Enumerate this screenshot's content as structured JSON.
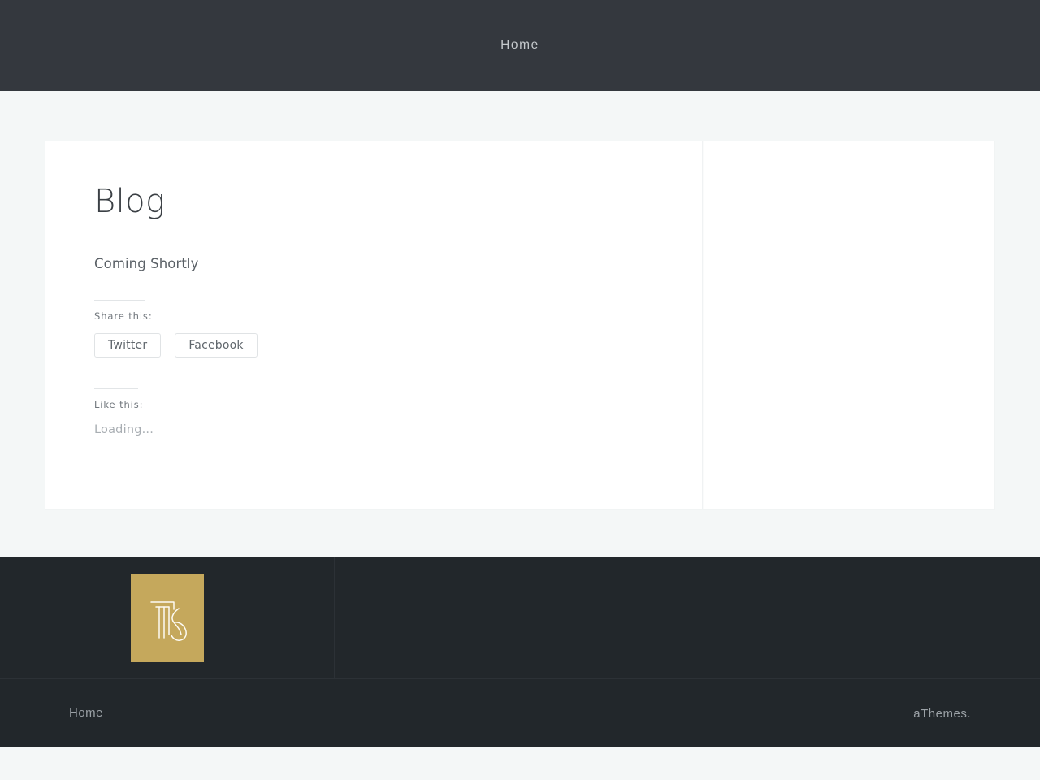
{
  "header": {
    "nav": [
      {
        "label": "Home"
      }
    ]
  },
  "main": {
    "title": "Blog",
    "body_text": "Coming Shortly",
    "share": {
      "title": "Share this:",
      "buttons": [
        {
          "label": "Twitter"
        },
        {
          "label": "Facebook"
        }
      ]
    },
    "like": {
      "title": "Like this:",
      "status": "Loading..."
    }
  },
  "footer": {
    "logo": {
      "icon": "tk-monogram-logo",
      "background_color": "#c5a85c"
    },
    "nav": [
      {
        "label": "Home"
      }
    ],
    "credit": "aThemes."
  },
  "colors": {
    "header_background": "#34383e",
    "page_background": "#f4f7f7",
    "card_background": "#ffffff",
    "footer_background": "#22272b",
    "accent_gold": "#c5a85c",
    "heading_text": "#3b4045",
    "body_text": "#5a6066",
    "muted_text": "#a9aeb3"
  }
}
